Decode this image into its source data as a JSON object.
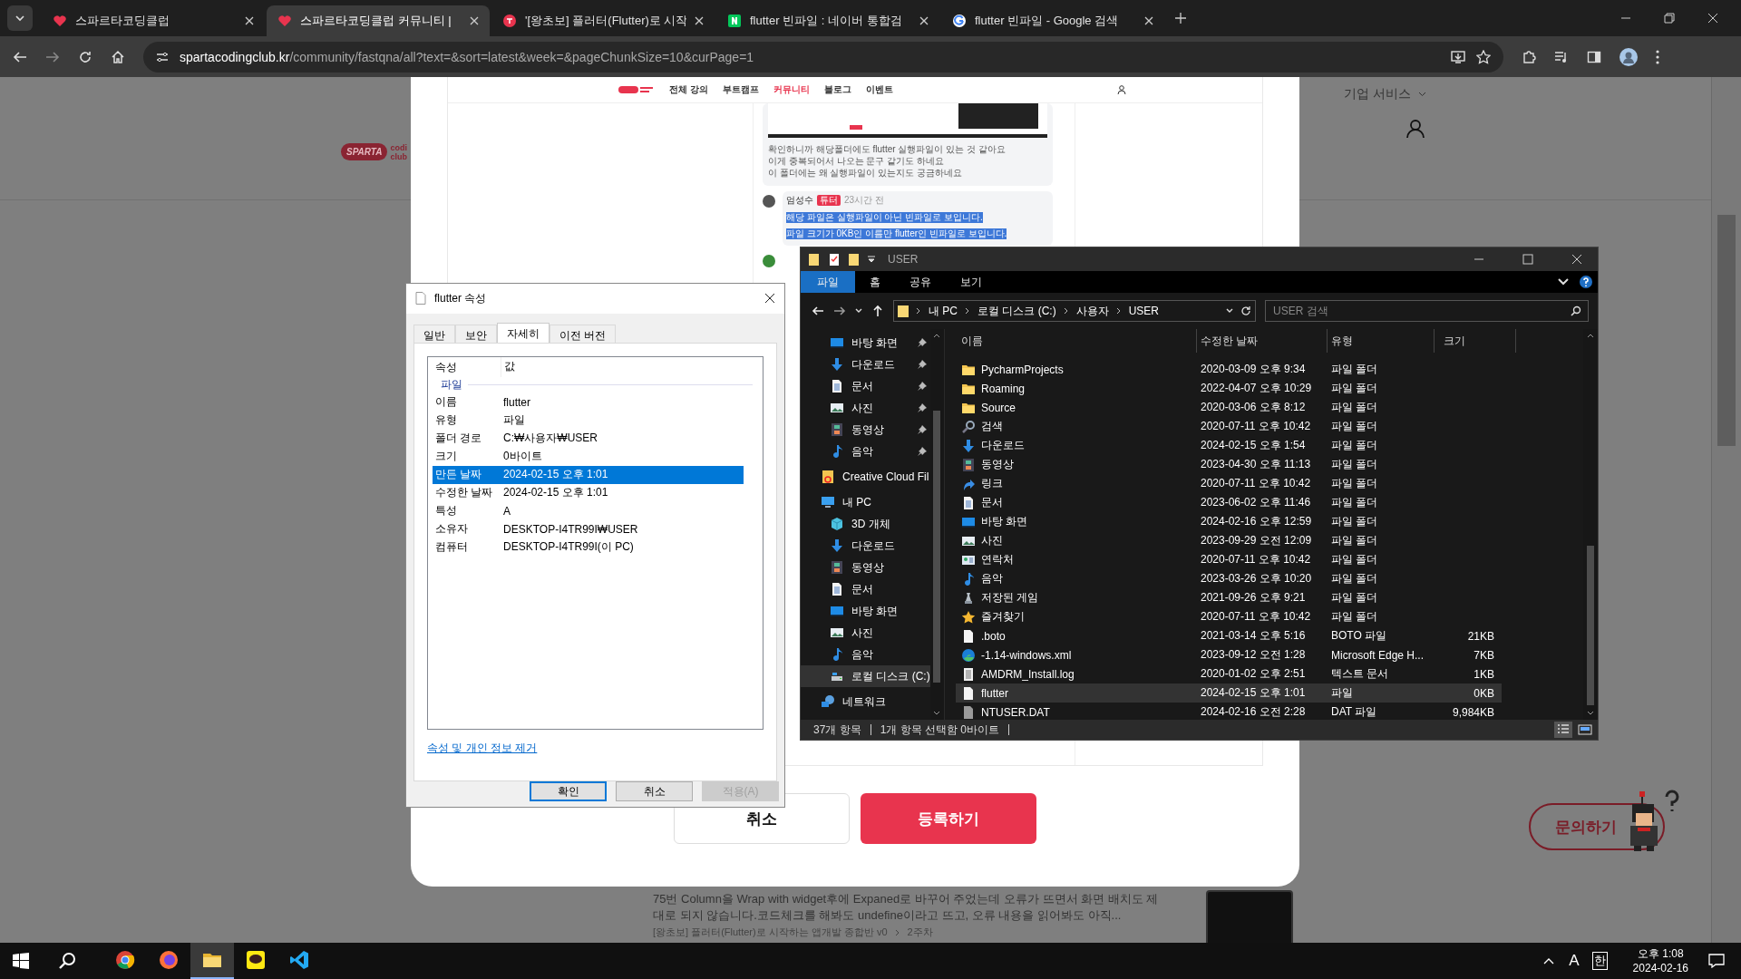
{
  "browser": {
    "tabs": [
      {
        "title": "스파르타코딩클럽",
        "kind": "heart",
        "selected": false
      },
      {
        "title": "스파르타코딩클럽 커뮤니티 |",
        "kind": "heart",
        "selected": true
      },
      {
        "title": "'[왕초보] 플러터(Flutter)로 시작",
        "kind": "round",
        "selected": false
      },
      {
        "title": "flutter 빈파일 : 네이버 통합검",
        "kind": "naver",
        "selected": false
      },
      {
        "title": "flutter 빈파일 - Google 검색",
        "kind": "google",
        "selected": false
      }
    ],
    "url_host": "spartacodingclub.kr",
    "url_path": "/community/fastqna/all?text=&sort=latest&week=&pageChunkSize=10&curPage=1"
  },
  "page": {
    "logo": {
      "mark": "SPARTA",
      "word_top": "codi",
      "word_bottom": "club"
    },
    "business_menu": "기업 서비스",
    "post": {
      "excerpt": "75번 Column을 Wrap with widget후에 Expaned로 바꾸어 주었는데 오류가 뜨면서 화면 배치도 제대로 되지 않습니다.코드체크를 해봐도 undefine이라고 뜨고, 오류 내용을 읽어봐도 아직...",
      "course": "[왕초보] 플러터(Flutter)로 시작하는 앱개발 종합반 v0",
      "week": "2주차"
    },
    "inquiry_button": "문의하기"
  },
  "modal": {
    "screenshot": {
      "nav": [
        {
          "label": "전체 강의",
          "selected": false
        },
        {
          "label": "부트캠프",
          "selected": false
        },
        {
          "label": "커뮤니티",
          "selected": true
        },
        {
          "label": "블로그",
          "selected": false
        },
        {
          "label": "이벤트",
          "selected": false
        }
      ],
      "card_lines": [
        "확인하니까 해당폴더에도 flutter 실행파일이 있는 것 같아요",
        "이게 중복되어서 나오는 문구 같기도 하네요",
        "이 폴더에는 왜 실행파일이 있는지도 궁금하네요"
      ],
      "comment": {
        "author": "엄성수",
        "badge": "튜터",
        "time": "23시간 전",
        "lines": [
          "해당 파일은 실행파일이 아닌 빈파일로 보입니다.",
          "파일 크기가 0KB인 이름만 flutter인 빈파일로 보입니다."
        ]
      }
    },
    "buttons": [
      {
        "label": "취소",
        "kind": "secondary"
      },
      {
        "label": "등록하기",
        "kind": "primary"
      }
    ]
  },
  "properties_dialog": {
    "title": "flutter 속성",
    "tabs": [
      {
        "label": "일반",
        "selected": false
      },
      {
        "label": "보안",
        "selected": false
      },
      {
        "label": "자세히",
        "selected": true
      },
      {
        "label": "이전 버전",
        "selected": false
      }
    ],
    "columns": [
      "속성",
      "값"
    ],
    "group": "파일",
    "rows": [
      {
        "property": "이름",
        "value": "flutter",
        "selected": false
      },
      {
        "property": "유형",
        "value": "파일",
        "selected": false
      },
      {
        "property": "폴더 경로",
        "value": "C:₩사용자₩USER",
        "selected": false
      },
      {
        "property": "크기",
        "value": "0바이트",
        "selected": false
      },
      {
        "property": "만든 날짜",
        "value": "2024-02-15 오후 1:01",
        "selected": true
      },
      {
        "property": "수정한 날짜",
        "value": "2024-02-15 오후 1:01",
        "selected": false
      },
      {
        "property": "특성",
        "value": "A",
        "selected": false
      },
      {
        "property": "소유자",
        "value": "DESKTOP-I4TR99I₩USER",
        "selected": false
      },
      {
        "property": "컴퓨터",
        "value": "DESKTOP-I4TR99I(이 PC)",
        "selected": false
      }
    ],
    "link": "속성 및 개인 정보 제거",
    "buttons": [
      {
        "label": "확인",
        "kind": "default",
        "disabled": false
      },
      {
        "label": "취소",
        "kind": "normal",
        "disabled": false
      },
      {
        "label": "적용(A)",
        "kind": "normal",
        "disabled": true
      }
    ]
  },
  "explorer": {
    "title": "USER",
    "ribbon_tabs": [
      {
        "label": "파일",
        "selected": true
      },
      {
        "label": "홈",
        "selected": false
      },
      {
        "label": "공유",
        "selected": false
      },
      {
        "label": "보기",
        "selected": false
      }
    ],
    "breadcrumb": [
      "내 PC",
      "로컬 디스크 (C:)",
      "사용자",
      "USER"
    ],
    "search": {
      "placeholder": "USER 검색"
    },
    "nav": [
      {
        "label": "바탕 화면",
        "kind": "desktop",
        "pinned": true,
        "selected": false
      },
      {
        "label": "다운로드",
        "kind": "download",
        "pinned": true,
        "selected": false
      },
      {
        "label": "문서",
        "kind": "doc",
        "pinned": true,
        "selected": false
      },
      {
        "label": "사진",
        "kind": "photo",
        "pinned": true,
        "selected": false
      },
      {
        "label": "동영상",
        "kind": "video",
        "pinned": true,
        "selected": false
      },
      {
        "label": "음악",
        "kind": "music",
        "pinned": true,
        "selected": false
      },
      {
        "label": "Creative Cloud Fil",
        "kind": "cc",
        "pinned": false,
        "selected": false
      },
      {
        "label": "내 PC",
        "kind": "pc",
        "pinned": false,
        "selected": false,
        "children": [
          {
            "label": "3D 개체",
            "kind": "cube",
            "selected": false
          },
          {
            "label": "다운로드",
            "kind": "download",
            "selected": false
          },
          {
            "label": "동영상",
            "kind": "video",
            "selected": false
          },
          {
            "label": "문서",
            "kind": "doc",
            "selected": false
          },
          {
            "label": "바탕 화면",
            "kind": "desktop",
            "selected": false
          },
          {
            "label": "사진",
            "kind": "photo",
            "selected": false
          },
          {
            "label": "음악",
            "kind": "music",
            "selected": false
          },
          {
            "label": "로컬 디스크 (C:)",
            "kind": "drive",
            "selected": true
          }
        ]
      },
      {
        "label": "네트워크",
        "kind": "network",
        "pinned": false,
        "selected": false
      }
    ],
    "columns": [
      "이름",
      "수정한 날짜",
      "유형",
      "크기"
    ],
    "files": [
      {
        "name": "PycharmProjects",
        "date": "2020-03-09 오후 9:34",
        "type": "파일 폴더",
        "kind": "folder",
        "selected": false
      },
      {
        "name": "Roaming",
        "date": "2022-04-07 오후 10:29",
        "type": "파일 폴더",
        "kind": "folder",
        "selected": false
      },
      {
        "name": "Source",
        "date": "2020-03-06 오후 8:12",
        "type": "파일 폴더",
        "kind": "folder",
        "selected": false
      },
      {
        "name": "검색",
        "date": "2020-07-11 오후 10:42",
        "type": "파일 폴더",
        "kind": "search",
        "selected": false
      },
      {
        "name": "다운로드",
        "date": "2024-02-15 오후 1:54",
        "type": "파일 폴더",
        "kind": "download",
        "selected": false
      },
      {
        "name": "동영상",
        "date": "2023-04-30 오후 11:13",
        "type": "파일 폴더",
        "kind": "video",
        "selected": false
      },
      {
        "name": "링크",
        "date": "2020-07-11 오후 10:42",
        "type": "파일 폴더",
        "kind": "link",
        "selected": false
      },
      {
        "name": "문서",
        "date": "2023-06-02 오후 11:46",
        "type": "파일 폴더",
        "kind": "doc",
        "selected": false
      },
      {
        "name": "바탕 화면",
        "date": "2024-02-16 오후 12:59",
        "type": "파일 폴더",
        "kind": "desktop",
        "selected": false
      },
      {
        "name": "사진",
        "date": "2023-09-29 오전 12:09",
        "type": "파일 폴더",
        "kind": "photo",
        "selected": false
      },
      {
        "name": "연락처",
        "date": "2020-07-11 오후 10:42",
        "type": "파일 폴더",
        "kind": "contact",
        "selected": false
      },
      {
        "name": "음악",
        "date": "2023-03-26 오후 10:20",
        "type": "파일 폴더",
        "kind": "music",
        "selected": false
      },
      {
        "name": "저장된 게임",
        "date": "2021-09-26 오후 9:21",
        "type": "파일 폴더",
        "kind": "game",
        "selected": false
      },
      {
        "name": "즐겨찾기",
        "date": "2020-07-11 오후 10:42",
        "type": "파일 폴더",
        "kind": "star",
        "selected": false
      },
      {
        "name": ".boto",
        "date": "2021-03-14 오후 5:16",
        "type": "BOTO 파일",
        "size": "21KB",
        "kind": "file",
        "selected": false
      },
      {
        "name": "-1.14-windows.xml",
        "date": "2023-09-12 오전 1:28",
        "type": "Microsoft Edge H...",
        "size": "7KB",
        "kind": "edge",
        "selected": false
      },
      {
        "name": "AMDRM_Install.log",
        "date": "2020-01-02 오후 2:51",
        "type": "텍스트 문서",
        "size": "1KB",
        "kind": "text",
        "selected": false
      },
      {
        "name": "flutter",
        "date": "2024-02-15 오후 1:01",
        "type": "파일",
        "size": "0KB",
        "kind": "file",
        "selected": true
      },
      {
        "name": "NTUSER.DAT",
        "date": "2024-02-16 오전 2:28",
        "type": "DAT 파일",
        "size": "9,984KB",
        "kind": "dat",
        "selected": false
      }
    ],
    "status": {
      "count": "37개 항목",
      "selection": "1개 항목 선택함 0바이트"
    }
  },
  "taskbar": {
    "apps": [
      {
        "kind": "chrome",
        "active": false
      },
      {
        "kind": "firefox",
        "active": false
      },
      {
        "kind": "explorer",
        "active": true
      },
      {
        "kind": "talk",
        "active": false
      },
      {
        "kind": "code",
        "active": false
      }
    ],
    "tray": {
      "input_mode": "A",
      "ime": "한",
      "time": "오후 1:08",
      "date": "2024-02-16"
    }
  }
}
